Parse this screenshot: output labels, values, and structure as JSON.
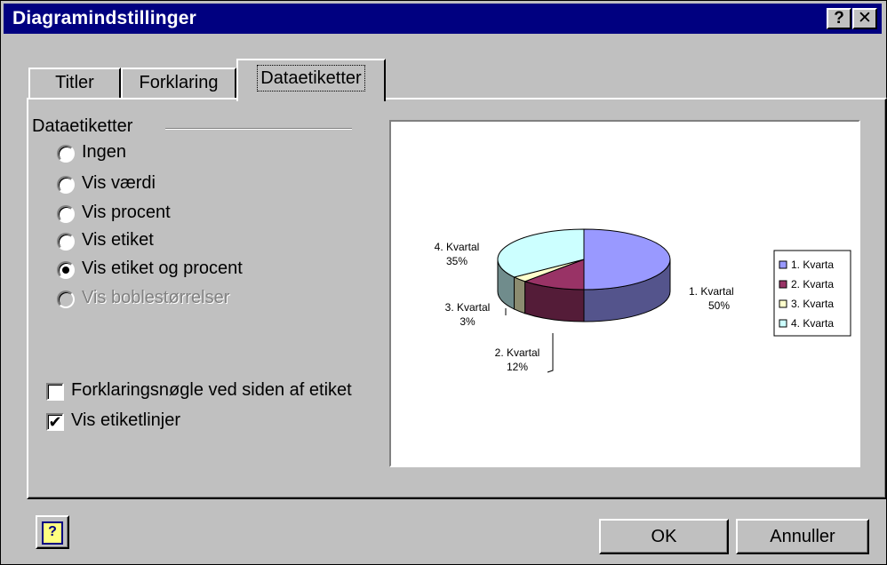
{
  "window": {
    "title": "Diagramindstillinger",
    "help_glyph": "?",
    "close_glyph": "✕"
  },
  "tabs": [
    {
      "label": "Titler"
    },
    {
      "label": "Forklaring"
    },
    {
      "label": "Dataetiketter",
      "active": true
    }
  ],
  "group": {
    "label": "Dataetiketter",
    "options": [
      {
        "label": "Ingen",
        "checked": false,
        "disabled": false
      },
      {
        "label": "Vis værdi",
        "checked": false,
        "disabled": false
      },
      {
        "label": "Vis procent",
        "checked": false,
        "disabled": false
      },
      {
        "label": "Vis etiket",
        "checked": false,
        "disabled": false
      },
      {
        "label": "Vis etiket og procent",
        "checked": true,
        "disabled": false
      },
      {
        "label": "Vis boblestørrelser",
        "checked": false,
        "disabled": true
      }
    ]
  },
  "checkboxes": [
    {
      "label": "Forklaringsnøgle ved siden af etiket",
      "checked": false
    },
    {
      "label": "Vis etiketlinjer",
      "checked": true
    }
  ],
  "chart_data": {
    "type": "pie",
    "categories": [
      "1. Kvartal",
      "2. Kvartal",
      "3. Kvartal",
      "4. Kvartal"
    ],
    "values": [
      50,
      12,
      3,
      35
    ],
    "data_labels": [
      "1. Kvartal\n50%",
      "2. Kvartal\n12%",
      "3. Kvartal\n3%",
      "4. Kvartal\n35%"
    ],
    "legend_entries": [
      "1. Kvarta",
      "2. Kvarta",
      "3. Kvarta",
      "4. Kvarta"
    ],
    "legend_position": "right",
    "colors": [
      "#9999ff",
      "#993366",
      "#ffffcc",
      "#ccffff"
    ]
  },
  "buttons": {
    "ok": "OK",
    "cancel": "Annuller"
  },
  "colors": {
    "titlebar": "#000080",
    "face": "#c0c0c0"
  }
}
